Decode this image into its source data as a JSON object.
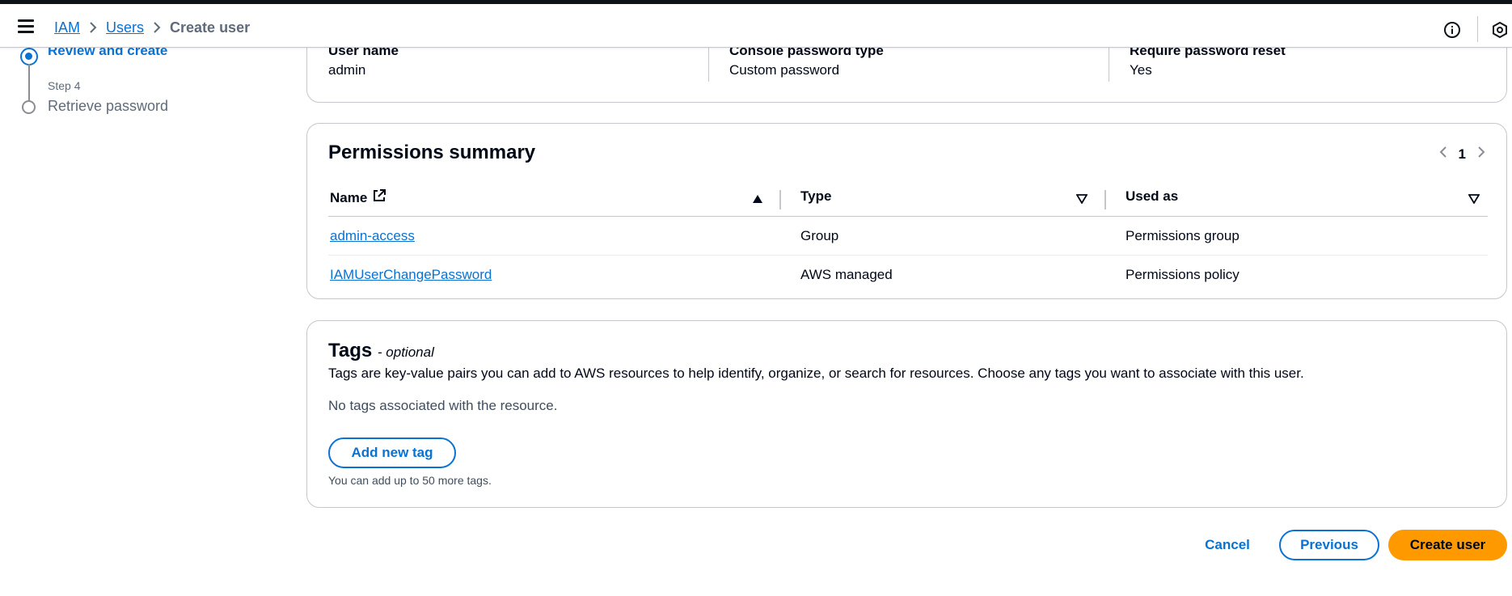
{
  "header": {
    "breadcrumb": [
      {
        "label": "IAM"
      },
      {
        "label": "Users"
      },
      {
        "label": "Create user"
      }
    ]
  },
  "steps": {
    "active_label": "Review and create",
    "next_step_number": "Step 4",
    "next_step_label": "Retrieve password"
  },
  "user_details": {
    "user_name_key": "User name",
    "user_name_value": "admin",
    "password_type_key": "Console password type",
    "password_type_value": "Custom password",
    "reset_key": "Require password reset",
    "reset_value": "Yes"
  },
  "permissions": {
    "title": "Permissions summary",
    "page": "1",
    "columns": [
      "Name",
      "Type",
      "Used as"
    ],
    "rows": [
      {
        "name": "admin-access",
        "type": "Group",
        "used_as": "Permissions group"
      },
      {
        "name": "IAMUserChangePassword",
        "type": "AWS managed",
        "used_as": "Permissions policy"
      }
    ]
  },
  "tags": {
    "title": "Tags",
    "optional": "- optional",
    "description": "Tags are key-value pairs you can add to AWS resources to help identify, organize, or search for resources. Choose any tags you want to associate with this user.",
    "empty": "No tags associated with the resource.",
    "add_button": "Add new tag",
    "hint": "You can add up to 50 more tags."
  },
  "actions": {
    "cancel": "Cancel",
    "previous": "Previous",
    "create": "Create user"
  },
  "colors": {
    "link": "#0972d3",
    "primary_button": "#ff9900",
    "border": "#c6c6cd"
  }
}
